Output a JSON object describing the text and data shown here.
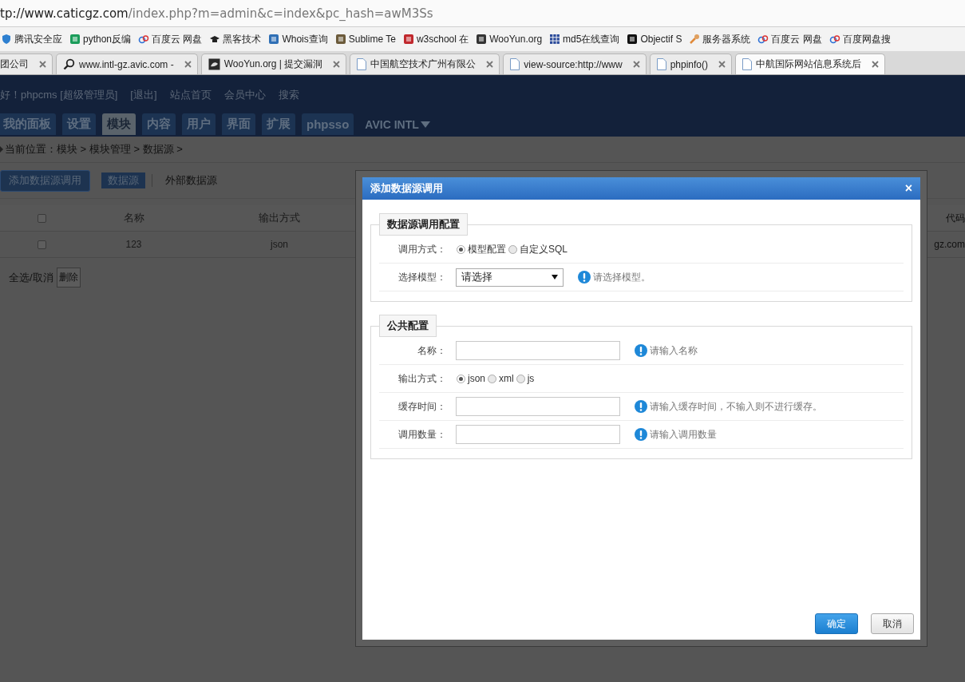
{
  "browser": {
    "url_host": "tp://www.caticgz.com",
    "url_path": "/index.php?m=admin&c=index&pc_hash=awM3Ss",
    "bookmarks": [
      {
        "label": "腾讯安全应",
        "kind": "shield"
      },
      {
        "label": "python反编",
        "kind": "tile",
        "color": "#1a9c5a"
      },
      {
        "label": "百度云 网盘",
        "kind": "cloud"
      },
      {
        "label": "黑客技术",
        "kind": "hat"
      },
      {
        "label": "Whois查询",
        "kind": "tile",
        "color": "#2f6fb5"
      },
      {
        "label": "Sublime Te",
        "kind": "tile",
        "color": "#6b5a3a"
      },
      {
        "label": "w3school 在",
        "kind": "tile",
        "color": "#c0282d"
      },
      {
        "label": "WooYun.org",
        "kind": "tile",
        "color": "#333333"
      },
      {
        "label": "md5在线查询",
        "kind": "grid"
      },
      {
        "label": "Objectif S",
        "kind": "tile",
        "color": "#111111"
      },
      {
        "label": "服务器系统",
        "kind": "tool"
      },
      {
        "label": "百度云 网盘",
        "kind": "cloud"
      },
      {
        "label": "百度网盘搜",
        "kind": "cloud"
      }
    ],
    "tabs": [
      {
        "title": "团公司",
        "kind": "none",
        "selected": false
      },
      {
        "title": "www.intl-gz.avic.com -",
        "kind": "search",
        "selected": false
      },
      {
        "title": "WooYun.org | 提交漏洞",
        "kind": "dark",
        "selected": false
      },
      {
        "title": "中国航空技术广州有限公",
        "kind": "page",
        "selected": false
      },
      {
        "title": "view-source:http://www",
        "kind": "page",
        "selected": false
      },
      {
        "title": "phpinfo()",
        "kind": "page",
        "selected": false
      },
      {
        "title": "中航国际网站信息系统后",
        "kind": "page",
        "selected": true
      }
    ]
  },
  "header": {
    "greeting": "好！phpcms [超级管理员]",
    "links": [
      "[退出]",
      "站点首页",
      "会员中心",
      "搜索"
    ],
    "nav": [
      {
        "label": "我的面板",
        "selected": false
      },
      {
        "label": "设置",
        "selected": false
      },
      {
        "label": "模块",
        "selected": true
      },
      {
        "label": "内容",
        "selected": false
      },
      {
        "label": "用户",
        "selected": false
      },
      {
        "label": "界面",
        "selected": false
      },
      {
        "label": "扩展",
        "selected": false
      },
      {
        "label": "phpsso",
        "selected": false
      }
    ],
    "site_menu": "AVIC INTL"
  },
  "breadcrumb": "当前位置：模块 > 模块管理 > 数据源 >",
  "subnav": {
    "add_button": "添加数据源调用",
    "tabs": [
      {
        "label": "数据源",
        "selected": true
      },
      {
        "label": "外部数据源",
        "selected": false
      }
    ]
  },
  "table": {
    "header_checked": false,
    "columns": [
      "名称",
      "输出方式",
      "代码"
    ],
    "rows": [
      {
        "checked": false,
        "cells": [
          "123",
          "json",
          "gz.com"
        ]
      }
    ]
  },
  "footer": {
    "select_all": "全选/取消",
    "delete": "删除"
  },
  "dialog": {
    "title": "添加数据源调用",
    "close": "×",
    "sections": [
      {
        "legend": "数据源调用配置",
        "rows": [
          {
            "kind": "radio",
            "label": "调用方式：",
            "options": [
              {
                "label": "模型配置",
                "selected": true
              },
              {
                "label": "自定义SQL",
                "selected": false
              }
            ]
          },
          {
            "kind": "select",
            "label": "选择模型：",
            "value": "请选择",
            "hint": "请选择模型。"
          }
        ]
      },
      {
        "legend": "公共配置",
        "rows": [
          {
            "kind": "input",
            "label": "名称：",
            "hint": "请输入名称"
          },
          {
            "kind": "radio",
            "label": "输出方式：",
            "options": [
              {
                "label": "json",
                "selected": true
              },
              {
                "label": "xml",
                "selected": false
              },
              {
                "label": "js",
                "selected": false
              }
            ]
          },
          {
            "kind": "input",
            "label": "缓存时间：",
            "hint": "请输入缓存时间，不输入则不进行缓存。"
          },
          {
            "kind": "input",
            "label": "调用数量：",
            "hint": "请输入调用数量"
          }
        ]
      }
    ],
    "ok": "确定",
    "cancel": "取消"
  }
}
